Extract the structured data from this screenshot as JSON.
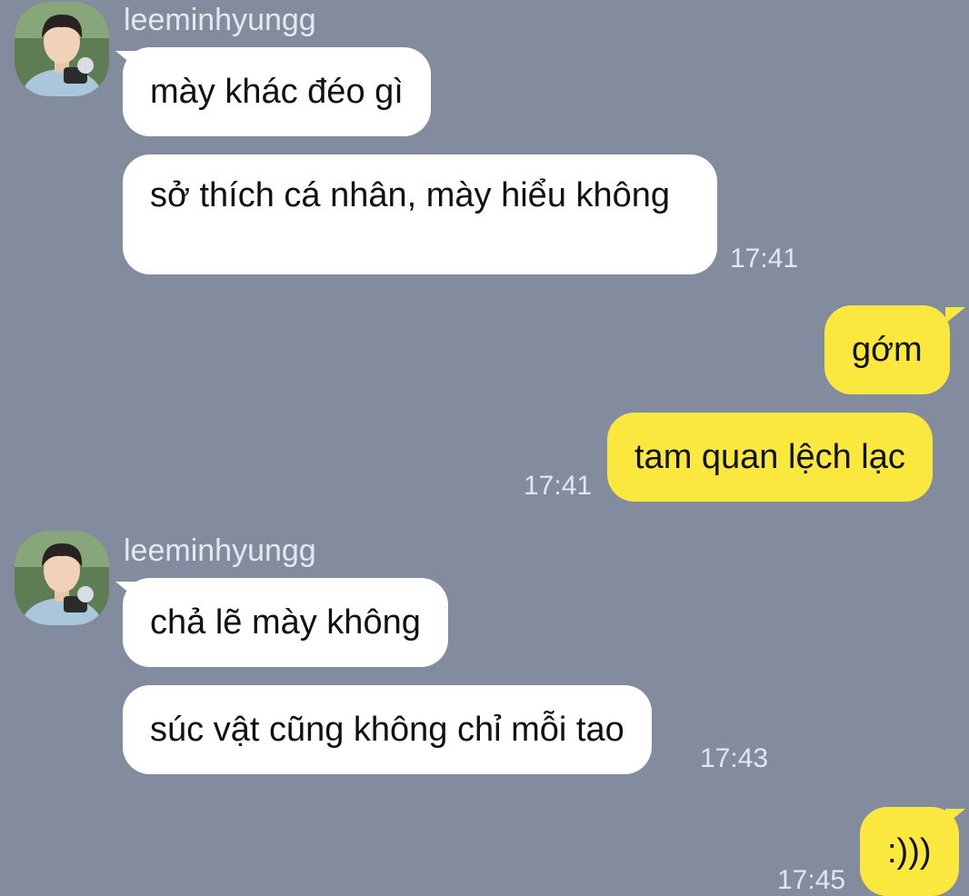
{
  "conversation": {
    "groups": [
      {
        "sender": "leeminhyungg",
        "side": "incoming",
        "messages": [
          "mày khác đéo gì",
          "sở thích cá nhân, mày hiểu không"
        ],
        "time": "17:41"
      },
      {
        "side": "outgoing",
        "messages": [
          "gớm",
          "tam quan lệch lạc"
        ],
        "time": "17:41"
      },
      {
        "sender": "leeminhyungg",
        "side": "incoming",
        "messages": [
          "chả lẽ mày không",
          "súc vật cũng không chỉ mỗi tao"
        ],
        "time": "17:43"
      },
      {
        "side": "outgoing",
        "messages": [
          ":)))"
        ],
        "time": "17:45"
      }
    ]
  },
  "colors": {
    "background": "#838b9e",
    "incoming_bubble": "#ffffff",
    "outgoing_bubble": "#fbe83f",
    "meta_text": "#e3e6ec"
  }
}
